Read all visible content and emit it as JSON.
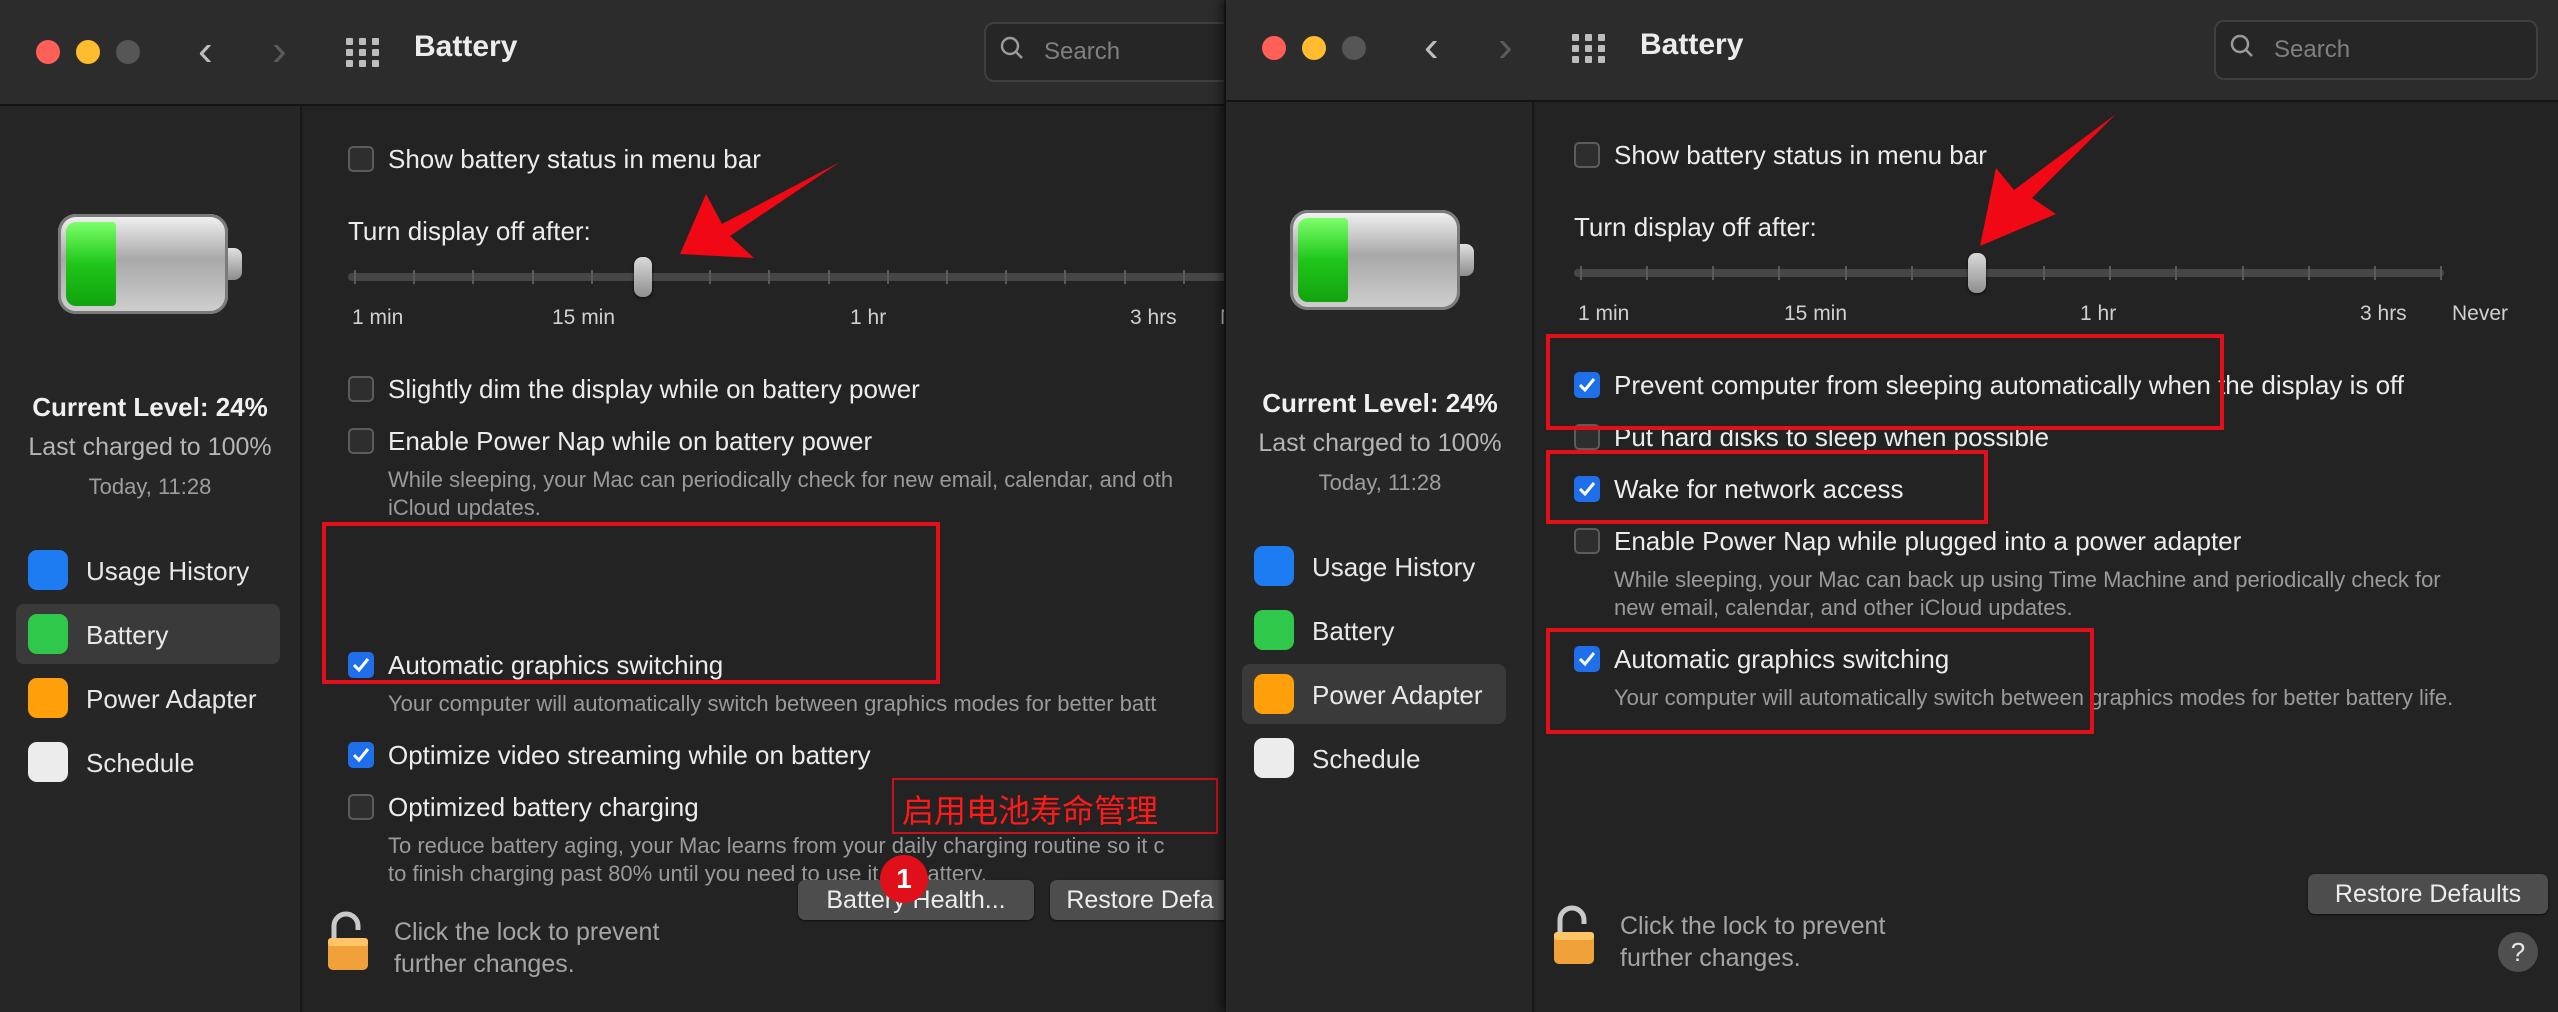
{
  "left": {
    "title": "Battery",
    "search_placeholder": "Search",
    "level": {
      "current": "Current Level: 24%",
      "last_charged": "Last charged to 100%",
      "time": "Today, 11:28"
    },
    "battery_percent": 24,
    "sidebar": [
      {
        "label": "Usage History",
        "icon": "bar-chart-icon",
        "selected": false
      },
      {
        "label": "Battery",
        "icon": "battery-icon",
        "selected": true
      },
      {
        "label": "Power Adapter",
        "icon": "lightning-icon",
        "selected": false
      },
      {
        "label": "Schedule",
        "icon": "calendar-icon",
        "selected": false
      }
    ],
    "show_status": {
      "label": "Show battery status in menu bar",
      "checked": false
    },
    "display_off": {
      "label": "Turn display off after:",
      "ticks": [
        "1 min",
        "15 min",
        "1 hr",
        "3 hrs",
        "Never"
      ],
      "truncated_tick": "N"
    },
    "options": {
      "dim": {
        "label": "Slightly dim the display while on battery power",
        "checked": false
      },
      "power_nap": {
        "label": "Enable Power Nap while on battery power",
        "checked": false,
        "desc1": "While sleeping, your Mac can periodically check for new email, calendar, and oth",
        "desc2": "iCloud updates."
      },
      "graphics": {
        "label": "Automatic graphics switching",
        "checked": true,
        "desc": "Your computer will automatically switch between graphics modes for better batt"
      },
      "video": {
        "label": "Optimize video streaming while on battery",
        "checked": true
      },
      "optimized": {
        "label": "Optimized battery charging",
        "checked": false,
        "desc1": "To reduce battery aging, your Mac learns from your daily charging routine so it c",
        "desc2": "to finish charging past 80% until you need to use it on battery."
      }
    },
    "buttons": {
      "health": "Battery Health...",
      "restore": "Restore Defa"
    },
    "lock_text": {
      "line1": "Click the lock to prevent",
      "line2": "further changes."
    },
    "annotation": {
      "note": "启用电池寿命管理",
      "badge": "1"
    }
  },
  "right": {
    "title": "Battery",
    "search_placeholder": "Search",
    "level": {
      "current": "Current Level: 24%",
      "last_charged": "Last charged to 100%",
      "time": "Today, 11:28"
    },
    "battery_percent": 24,
    "sidebar": [
      {
        "label": "Usage History",
        "icon": "bar-chart-icon",
        "selected": false
      },
      {
        "label": "Battery",
        "icon": "battery-icon",
        "selected": false
      },
      {
        "label": "Power Adapter",
        "icon": "lightning-icon",
        "selected": true
      },
      {
        "label": "Schedule",
        "icon": "calendar-icon",
        "selected": false
      }
    ],
    "show_status": {
      "label": "Show battery status in menu bar",
      "checked": false
    },
    "display_off": {
      "label": "Turn display off after:",
      "ticks": [
        "1 min",
        "15 min",
        "1 hr",
        "3 hrs",
        "Never"
      ]
    },
    "options": {
      "prevent": {
        "label": "Prevent computer from sleeping automatically when the display is off",
        "checked": true
      },
      "hdd": {
        "label": "Put hard disks to sleep when possible",
        "checked": false
      },
      "wake": {
        "label": "Wake for network access",
        "checked": true
      },
      "power_nap": {
        "label": "Enable Power Nap while plugged into a power adapter",
        "checked": false,
        "desc1": "While sleeping, your Mac can back up using Time Machine and periodically check for",
        "desc2": "new email, calendar, and other iCloud updates."
      },
      "graphics": {
        "label": "Automatic graphics switching",
        "checked": true,
        "desc": "Your computer will automatically switch between graphics modes for better battery life."
      }
    },
    "buttons": {
      "restore": "Restore Defaults",
      "help": "?"
    },
    "lock_text": {
      "line1": "Click the lock to prevent",
      "line2": "further changes."
    }
  },
  "colors": {
    "accent": "#1f6feb",
    "annotation_red": "#e3101b",
    "battery_green": "#1fc61a"
  }
}
